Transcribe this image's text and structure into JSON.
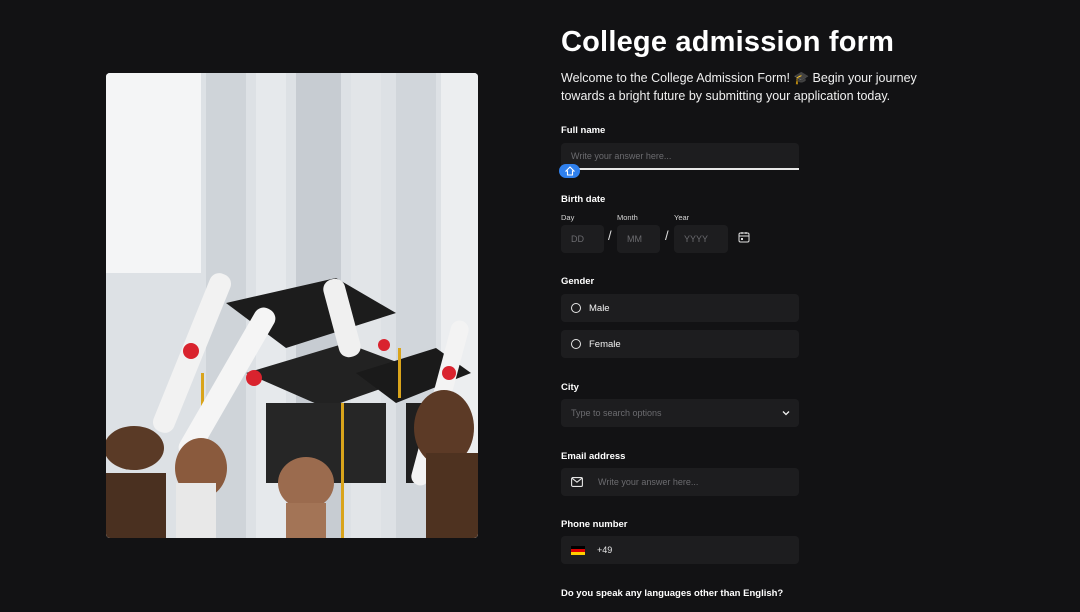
{
  "form": {
    "title": "College admission form",
    "intro": "Welcome to the College Admission Form! 🎓 Begin your journey towards a bright future by submitting your application today.",
    "full_name": {
      "label": "Full name",
      "placeholder": "Write your answer here..."
    },
    "birth_date": {
      "label": "Birth date",
      "day_label": "Day",
      "month_label": "Month",
      "year_label": "Year",
      "day_placeholder": "DD",
      "month_placeholder": "MM",
      "year_placeholder": "YYYY",
      "separator": "/"
    },
    "gender": {
      "label": "Gender",
      "options": [
        "Male",
        "Female"
      ]
    },
    "city": {
      "label": "City",
      "placeholder": "Type to search options"
    },
    "email": {
      "label": "Email address",
      "placeholder": "Write your answer here..."
    },
    "phone": {
      "label": "Phone number",
      "country_code": "+49"
    },
    "languages": {
      "label": "Do you speak any languages other than English?"
    }
  },
  "colors": {
    "background": "#121214",
    "field": "#1d1d1f",
    "accent": "#2f80ed"
  }
}
